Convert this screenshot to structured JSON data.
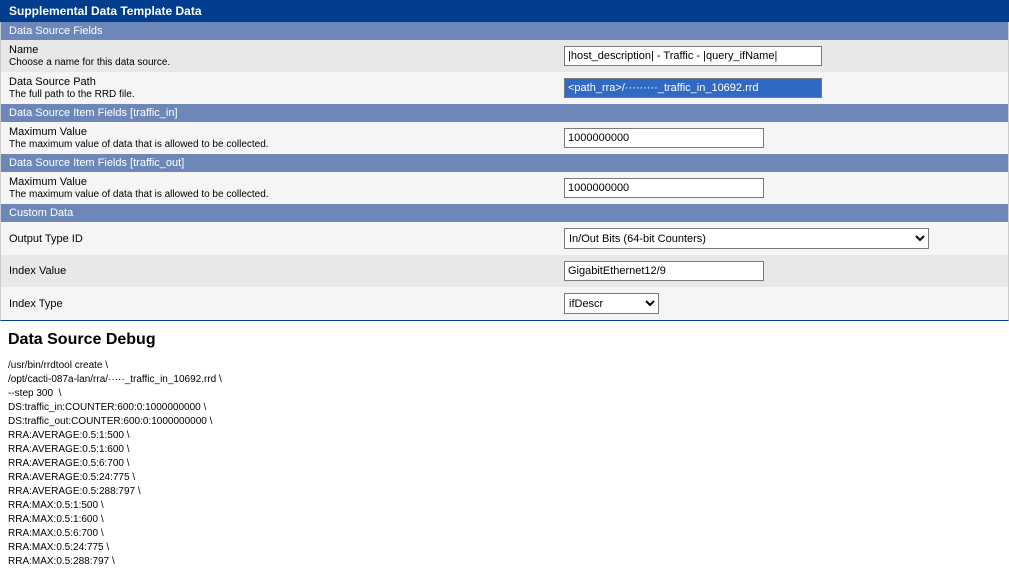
{
  "header_main": "Supplemental Data Template Data",
  "sections": {
    "dsFields": "Data Source Fields",
    "dsItemIn": "Data Source Item Fields [traffic_in]",
    "dsItemOut": "Data Source Item Fields [traffic_out]",
    "custom": "Custom Data"
  },
  "name": {
    "label": "Name",
    "desc": "Choose a name for this data source.",
    "value": "|host_description| - Traffic - |query_ifName|"
  },
  "path": {
    "label": "Data Source Path",
    "desc": "The full path to the RRD file.",
    "value": "<path_rra>/·········_traffic_in_10692.rrd"
  },
  "maxIn": {
    "label": "Maximum Value",
    "desc": "The maximum value of data that is allowed to be collected.",
    "value": "1000000000"
  },
  "maxOut": {
    "label": "Maximum Value",
    "desc": "The maximum value of data that is allowed to be collected.",
    "value": "1000000000"
  },
  "outputType": {
    "label": "Output Type ID",
    "value": "In/Out Bits (64-bit Counters)"
  },
  "indexValue": {
    "label": "Index Value",
    "value": "GigabitEthernet12/9"
  },
  "indexType": {
    "label": "Index Type",
    "value": "ifDescr"
  },
  "debug": {
    "title": "Data Source Debug",
    "lines": [
      "/usr/bin/rrdtool create \\",
      "/opt/cacti-087a-lan/rra/·····_traffic_in_10692.rrd \\",
      "--step 300  \\",
      "DS:traffic_in:COUNTER:600:0:1000000000 \\",
      "DS:traffic_out:COUNTER:600:0:1000000000 \\",
      "RRA:AVERAGE:0.5:1:500 \\",
      "RRA:AVERAGE:0.5:1:600 \\",
      "RRA:AVERAGE:0.5:6:700 \\",
      "RRA:AVERAGE:0.5:24:775 \\",
      "RRA:AVERAGE:0.5:288:797 \\",
      "RRA:MAX:0.5:1:500 \\",
      "RRA:MAX:0.5:1:600 \\",
      "RRA:MAX:0.5:6:700 \\",
      "RRA:MAX:0.5:24:775 \\",
      "RRA:MAX:0.5:288:797 \\"
    ]
  }
}
